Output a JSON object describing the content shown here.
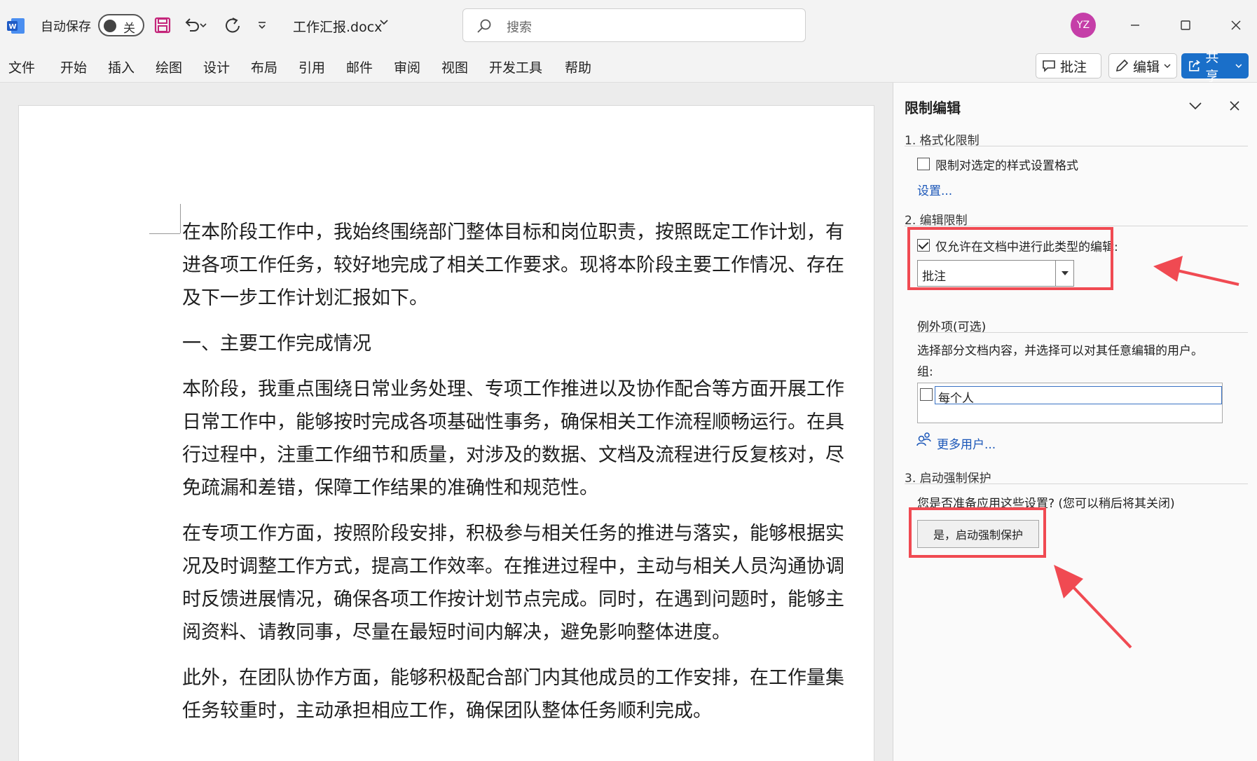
{
  "titlebar": {
    "autosave_label": "自动保存",
    "autosave_state": "关",
    "doc_title": "工作汇报.docx",
    "search_placeholder": "搜索",
    "avatar_initials": "YZ"
  },
  "ribbon": {
    "tabs": [
      "文件",
      "开始",
      "插入",
      "绘图",
      "设计",
      "布局",
      "引用",
      "邮件",
      "审阅",
      "视图",
      "开发工具",
      "帮助"
    ],
    "comment_button": "批注",
    "edit_button": "编辑",
    "share_button": "共享"
  },
  "document": {
    "paragraphs": [
      [
        "在本阶段工作中，我始终围绕部门整体目标和岗位职责，按照既定工作计划，有",
        "进各项工作任务，较好地完成了相关工作要求。现将本阶段主要工作情况、存在",
        "及下一步工作计划汇报如下。"
      ],
      [
        "一、主要工作完成情况"
      ],
      [
        "本阶段，我重点围绕日常业务处理、专项工作推进以及协作配合等方面开展工作",
        "日常工作中，能够按时完成各项基础性事务，确保相关工作流程顺畅运行。在具",
        "行过程中，注重工作细节和质量，对涉及的数据、文档及流程进行反复核对，尽",
        "免疏漏和差错，保障工作结果的准确性和规范性。"
      ],
      [
        "在专项工作方面，按照阶段安排，积极参与相关任务的推进与落实，能够根据实",
        "况及时调整工作方式，提高工作效率。在推进过程中，主动与相关人员沟通协调",
        "时反馈进展情况，确保各项工作按计划节点完成。同时，在遇到问题时，能够主",
        "阅资料、请教同事，尽量在最短时间内解决，避免影响整体进度。"
      ],
      [
        "此外，在团队协作方面，能够积极配合部门内其他成员的工作安排，在工作量集",
        "任务较重时，主动承担相应工作，确保团队整体任务顺利完成。"
      ]
    ]
  },
  "pane": {
    "title": "限制编辑",
    "section1_title": "1. 格式化限制",
    "format_checkbox_label": "限制对选定的样式设置格式",
    "format_checkbox_checked": false,
    "settings_link": "设置...",
    "section2_title": "2. 编辑限制",
    "edit_checkbox_label": "仅允许在文档中进行此类型的编辑:",
    "edit_checkbox_checked": true,
    "edit_type_value": "批注",
    "exceptions_title": "例外项(可选)",
    "exceptions_desc": "选择部分文档内容，并选择可以对其任意编辑的用户。",
    "group_label": "组:",
    "group_item": "每个人",
    "more_users_link": "更多用户...",
    "section3_title": "3. 启动强制保护",
    "section3_question": "您是否准备应用这些设置? (您可以稍后将其关闭)",
    "start_button": "是，启动强制保护"
  },
  "colors": {
    "accent": "#1a6fc9",
    "highlight": "#f04a52",
    "avatar": "#c53ea8"
  }
}
